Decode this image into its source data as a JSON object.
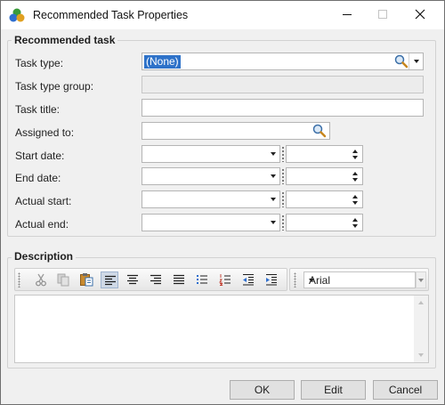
{
  "window": {
    "title": "Recommended Task Properties"
  },
  "task_group": {
    "title": "Recommended task",
    "task_type_label": "Task type:",
    "task_type_value": "(None)",
    "task_type_group_label": "Task type group:",
    "task_title_label": "Task title:",
    "assigned_to_label": "Assigned to:",
    "start_date_label": "Start date:",
    "end_date_label": "End date:",
    "actual_start_label": "Actual start:",
    "actual_end_label": "Actual end:"
  },
  "description_group": {
    "title": "Description",
    "font_value": "Arial",
    "toolbar_icons": [
      "cut-icon",
      "copy-icon",
      "paste-icon",
      "align-left-icon",
      "align-center-icon",
      "align-right-icon",
      "justify-icon",
      "bullet-list-icon",
      "numbered-list-icon",
      "outdent-icon",
      "indent-icon"
    ]
  },
  "buttons": {
    "ok": "OK",
    "edit": "Edit",
    "cancel": "Cancel"
  },
  "colors": {
    "selection": "#2e72c9",
    "window_bg": "#f0f0f0",
    "titlebar_bg": "#ffffff"
  }
}
